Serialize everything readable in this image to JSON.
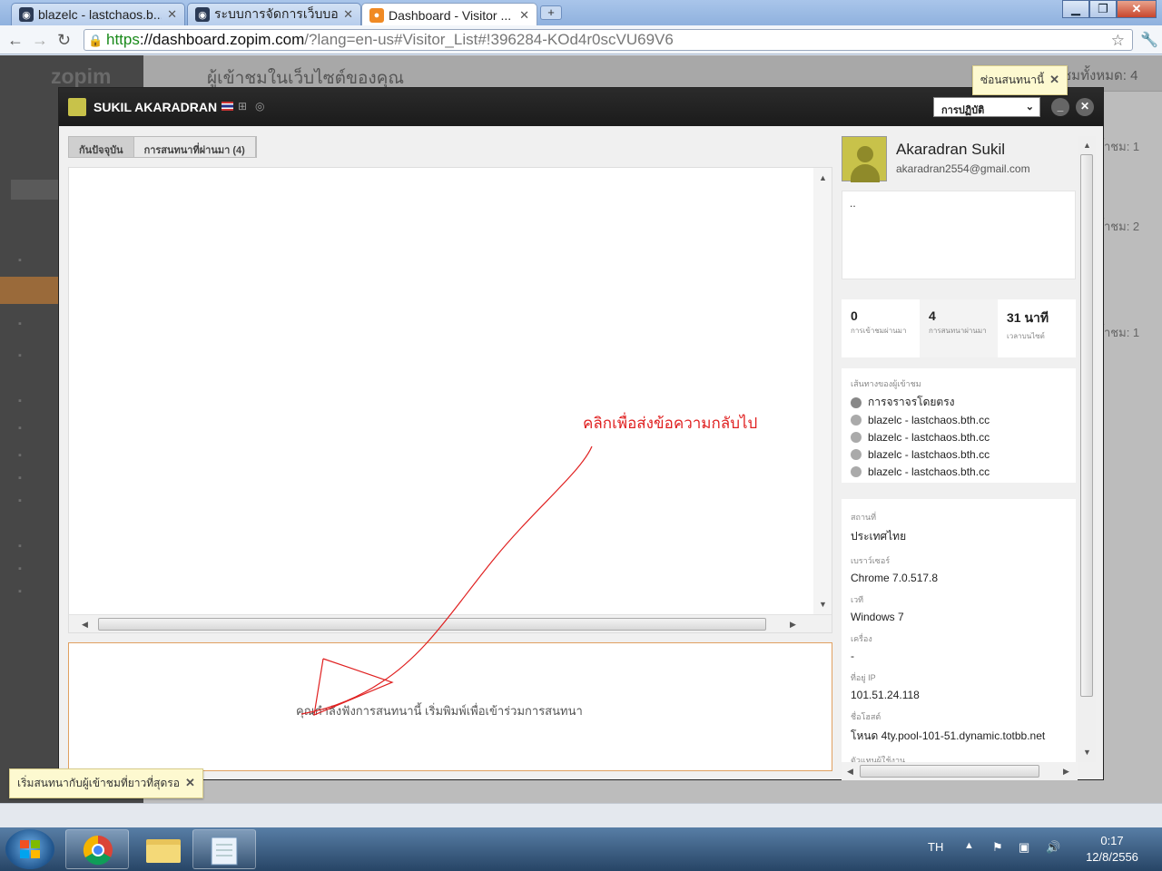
{
  "browser": {
    "tabs": [
      {
        "title": "blazelc - lastchaos.b...",
        "active": false
      },
      {
        "title": "ระบบการจัดการเว็บบอร์...",
        "active": false
      },
      {
        "title": "Dashboard - Visitor ...",
        "active": true
      }
    ],
    "url_scheme": "https",
    "url_host": "://dashboard.zopim.com",
    "url_rest": "/?lang=en-us#Visitor_List#!396284-KOd4r0scVU69V6"
  },
  "background": {
    "logo": "zopim",
    "header_title": "ผู้เข้าชมในเว็บไซต์ของคุณ",
    "header_right": "ชมทั้งหมด: 4",
    "rows": [
      "้าชม: 1",
      "้าชม: 2",
      "้าชม: 1"
    ]
  },
  "modal": {
    "visitor_name": "SUKIL AKARADRAN",
    "action_label": "การปฏิบัติ",
    "tab_current": "กันปัจจุบัน",
    "tab_past": "การสนทนาที่ผ่านมา (4)",
    "input_placeholder": "คุณกำลังฟังการสนทนานี้ เริ่มพิมพ์เพื่อเข้าร่วมการสนทนา"
  },
  "annotation": {
    "text": "คลิกเพื่อส่งข้อความกลับไป",
    "color": "#e02020"
  },
  "visitor": {
    "name": "Akaradran Sukil",
    "email": "akaradran2554@gmail.com",
    "notes": "..",
    "stats": [
      {
        "value": "0",
        "label": "การเข้าชมผ่านมา"
      },
      {
        "value": "4",
        "label": "การสนทนาผ่านมา"
      },
      {
        "value": "31 นาที",
        "label": "เวลาบนไซต์"
      }
    ],
    "path_caption": "เส้นทางของผู้เข้าชม",
    "path": [
      "การจราจรโดยตรง",
      "blazelc - lastchaos.bth.cc",
      "blazelc - lastchaos.bth.cc",
      "blazelc - lastchaos.bth.cc",
      "blazelc - lastchaos.bth.cc"
    ],
    "info": [
      {
        "key": "สถานที่",
        "value": "ประเทศไทย"
      },
      {
        "key": "เบราว์เซอร์",
        "value": "Chrome 7.0.517.8"
      },
      {
        "key": "เวที",
        "value": "Windows 7"
      },
      {
        "key": "เครื่อง",
        "value": "-"
      },
      {
        "key": "ที่อยู่ IP",
        "value": "101.51.24.118"
      },
      {
        "key": "ชื่อโฮสต์",
        "value": "โหนด 4ty.pool-101-51.dynamic.totbb.net"
      },
      {
        "key": "ตัวแทนผู้ใช้งาน",
        "value": ""
      }
    ]
  },
  "tooltips": {
    "hide_chat": "ซ่อนสนทนานี้",
    "start_chat": "เริ่มสนทนากับผู้เข้าชมที่ยาวที่สุดรอ"
  },
  "taskbar": {
    "lang": "TH",
    "time": "0:17",
    "date": "12/8/2556"
  }
}
